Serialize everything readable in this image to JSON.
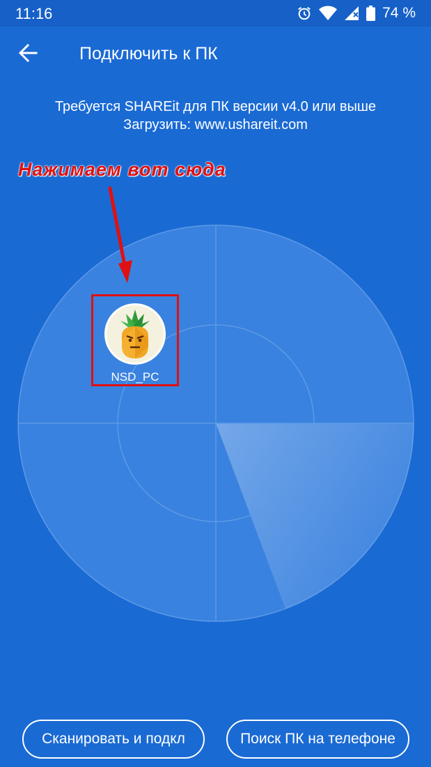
{
  "status_bar": {
    "time": "11:16",
    "battery": "74 %",
    "icons": [
      "alarm-icon",
      "wifi-icon",
      "signal-icon",
      "battery-icon"
    ]
  },
  "app_bar": {
    "back_icon": "arrow-back-icon",
    "title": "Подключить к ПК"
  },
  "info": {
    "line1": "Требуется SHAREit для ПК версии v4.0 или выше",
    "line2": "Загрузить: www.ushareit.com"
  },
  "annotation": {
    "text": "Нажимаем вот сюда",
    "color": "#e01010"
  },
  "device": {
    "name": "NSD_PC",
    "avatar_icon": "pineapple-avatar-icon"
  },
  "buttons": {
    "scan": "Сканировать и подкл",
    "search": "Поиск ПК на телефоне"
  },
  "colors": {
    "background": "#1a6ad4",
    "status_bar": "#1660c8",
    "annotation_red": "#e01010"
  }
}
